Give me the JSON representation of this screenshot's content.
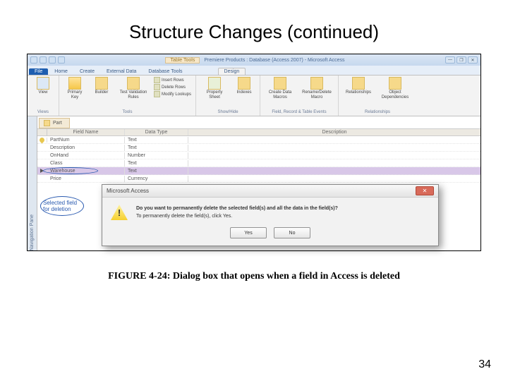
{
  "slide": {
    "title": "Structure Changes (continued)",
    "caption": "FIGURE 4-24: Dialog box that opens when a field in Access is deleted",
    "page_number": "34"
  },
  "window": {
    "context_tab": "Table Tools",
    "title": "Premiere Products : Database (Access 2007) - Microsoft Access",
    "tabs": {
      "file": "File",
      "home": "Home",
      "create": "Create",
      "external": "External Data",
      "dbtools": "Database Tools",
      "design": "Design"
    }
  },
  "ribbon": {
    "views": {
      "view": "View",
      "caption": "Views"
    },
    "tools": {
      "primary_key": "Primary Key",
      "builder": "Builder",
      "test_rules": "Test Validation Rules",
      "insert_rows": "Insert Rows",
      "delete_rows": "Delete Rows",
      "modify_lookups": "Modify Lookups",
      "caption": "Tools"
    },
    "showhide": {
      "property_sheet": "Property Sheet",
      "indexes": "Indexes",
      "caption": "Show/Hide"
    },
    "events": {
      "create_macros": "Create Data Macros",
      "rename_delete": "Rename/Delete Macro",
      "caption": "Field, Record & Table Events"
    },
    "relationships": {
      "relationships": "Relationships",
      "dependencies": "Object Dependencies",
      "caption": "Relationships"
    }
  },
  "navpane": {
    "label": "Navigation Pane"
  },
  "object_tab": "Part",
  "grid": {
    "headers": {
      "field_name": "Field Name",
      "data_type": "Data Type",
      "description": "Description"
    },
    "rows": [
      {
        "name": "PartNum",
        "type": "Text",
        "pk": true
      },
      {
        "name": "Description",
        "type": "Text"
      },
      {
        "name": "OnHand",
        "type": "Number"
      },
      {
        "name": "Class",
        "type": "Text"
      },
      {
        "name": "Warehouse",
        "type": "Text",
        "selected": true
      },
      {
        "name": "Price",
        "type": "Currency"
      }
    ]
  },
  "callout": {
    "line1": "Selected field",
    "line2": "for deletion"
  },
  "dialog": {
    "title": "Microsoft Access",
    "main": "Do you want to permanently delete the selected field(s) and all the data in the field(s)?",
    "sub": "To permanently delete the field(s), click Yes.",
    "yes": "Yes",
    "no": "No"
  }
}
